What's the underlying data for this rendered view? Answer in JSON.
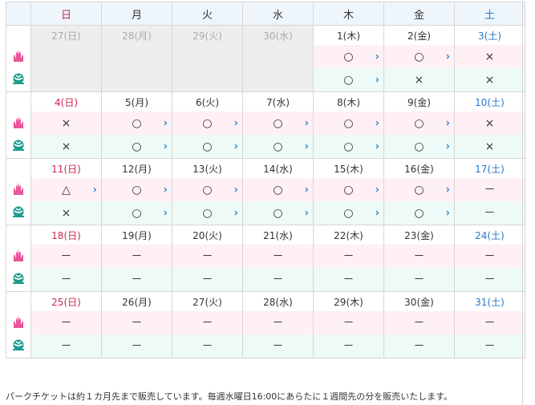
{
  "header": {
    "days": [
      {
        "label": "日",
        "kind": "sun"
      },
      {
        "label": "月",
        "kind": "wd"
      },
      {
        "label": "火",
        "kind": "wd"
      },
      {
        "label": "水",
        "kind": "wd"
      },
      {
        "label": "木",
        "kind": "wd"
      },
      {
        "label": "金",
        "kind": "wd"
      },
      {
        "label": "土",
        "kind": "sat"
      }
    ]
  },
  "park_icons": {
    "land": "castle-icon",
    "sea": "globe-icon"
  },
  "colors": {
    "sunday": "#c8294f",
    "saturday": "#2677c8",
    "land_bg": "#fff0f6",
    "sea_bg": "#eefaf7",
    "arrow": "#2b88c8"
  },
  "weeks": [
    {
      "days": [
        {
          "date": "27(日)",
          "kind": "sun",
          "other": true,
          "land": "",
          "land_link": false,
          "sea": "",
          "sea_link": false
        },
        {
          "date": "28(月)",
          "kind": "wd",
          "other": true,
          "land": "",
          "land_link": false,
          "sea": "",
          "sea_link": false
        },
        {
          "date": "29(火)",
          "kind": "wd",
          "other": true,
          "land": "",
          "land_link": false,
          "sea": "",
          "sea_link": false
        },
        {
          "date": "30(水)",
          "kind": "wd",
          "other": true,
          "land": "",
          "land_link": false,
          "sea": "",
          "sea_link": false
        },
        {
          "date": "1(木)",
          "kind": "wd",
          "other": false,
          "land": "○",
          "land_link": true,
          "sea": "○",
          "sea_link": true
        },
        {
          "date": "2(金)",
          "kind": "wd",
          "other": false,
          "land": "○",
          "land_link": true,
          "sea": "×",
          "sea_link": false
        },
        {
          "date": "3(土)",
          "kind": "sat",
          "other": false,
          "land": "×",
          "land_link": false,
          "sea": "×",
          "sea_link": false
        }
      ]
    },
    {
      "days": [
        {
          "date": "4(日)",
          "kind": "sun",
          "other": false,
          "land": "×",
          "land_link": false,
          "sea": "×",
          "sea_link": false
        },
        {
          "date": "5(月)",
          "kind": "wd",
          "other": false,
          "land": "○",
          "land_link": true,
          "sea": "○",
          "sea_link": true
        },
        {
          "date": "6(火)",
          "kind": "wd",
          "other": false,
          "land": "○",
          "land_link": true,
          "sea": "○",
          "sea_link": true
        },
        {
          "date": "7(水)",
          "kind": "wd",
          "other": false,
          "land": "○",
          "land_link": true,
          "sea": "○",
          "sea_link": true
        },
        {
          "date": "8(木)",
          "kind": "wd",
          "other": false,
          "land": "○",
          "land_link": true,
          "sea": "○",
          "sea_link": true
        },
        {
          "date": "9(金)",
          "kind": "wd",
          "other": false,
          "land": "○",
          "land_link": true,
          "sea": "○",
          "sea_link": true
        },
        {
          "date": "10(土)",
          "kind": "sat",
          "other": false,
          "land": "×",
          "land_link": false,
          "sea": "×",
          "sea_link": false
        }
      ]
    },
    {
      "days": [
        {
          "date": "11(日)",
          "kind": "sun",
          "other": false,
          "land": "△",
          "land_link": true,
          "sea": "×",
          "sea_link": false
        },
        {
          "date": "12(月)",
          "kind": "wd",
          "other": false,
          "land": "○",
          "land_link": true,
          "sea": "○",
          "sea_link": true
        },
        {
          "date": "13(火)",
          "kind": "wd",
          "other": false,
          "land": "○",
          "land_link": true,
          "sea": "○",
          "sea_link": true
        },
        {
          "date": "14(水)",
          "kind": "wd",
          "other": false,
          "land": "○",
          "land_link": true,
          "sea": "○",
          "sea_link": true
        },
        {
          "date": "15(木)",
          "kind": "wd",
          "other": false,
          "land": "○",
          "land_link": true,
          "sea": "○",
          "sea_link": true
        },
        {
          "date": "16(金)",
          "kind": "wd",
          "other": false,
          "land": "○",
          "land_link": true,
          "sea": "○",
          "sea_link": true
        },
        {
          "date": "17(土)",
          "kind": "sat",
          "other": false,
          "land": "－",
          "land_link": false,
          "sea": "－",
          "sea_link": false
        }
      ]
    },
    {
      "days": [
        {
          "date": "18(日)",
          "kind": "sun",
          "other": false,
          "land": "－",
          "land_link": false,
          "sea": "－",
          "sea_link": false
        },
        {
          "date": "19(月)",
          "kind": "wd",
          "other": false,
          "land": "－",
          "land_link": false,
          "sea": "－",
          "sea_link": false
        },
        {
          "date": "20(火)",
          "kind": "wd",
          "other": false,
          "land": "－",
          "land_link": false,
          "sea": "－",
          "sea_link": false
        },
        {
          "date": "21(水)",
          "kind": "wd",
          "other": false,
          "land": "－",
          "land_link": false,
          "sea": "－",
          "sea_link": false
        },
        {
          "date": "22(木)",
          "kind": "wd",
          "other": false,
          "land": "－",
          "land_link": false,
          "sea": "－",
          "sea_link": false
        },
        {
          "date": "23(金)",
          "kind": "wd",
          "other": false,
          "land": "－",
          "land_link": false,
          "sea": "－",
          "sea_link": false
        },
        {
          "date": "24(土)",
          "kind": "sat",
          "other": false,
          "land": "－",
          "land_link": false,
          "sea": "－",
          "sea_link": false
        }
      ]
    },
    {
      "days": [
        {
          "date": "25(日)",
          "kind": "sun",
          "other": false,
          "land": "－",
          "land_link": false,
          "sea": "－",
          "sea_link": false
        },
        {
          "date": "26(月)",
          "kind": "wd",
          "other": false,
          "land": "－",
          "land_link": false,
          "sea": "－",
          "sea_link": false
        },
        {
          "date": "27(火)",
          "kind": "wd",
          "other": false,
          "land": "－",
          "land_link": false,
          "sea": "－",
          "sea_link": false
        },
        {
          "date": "28(水)",
          "kind": "wd",
          "other": false,
          "land": "－",
          "land_link": false,
          "sea": "－",
          "sea_link": false
        },
        {
          "date": "29(木)",
          "kind": "wd",
          "other": false,
          "land": "－",
          "land_link": false,
          "sea": "－",
          "sea_link": false
        },
        {
          "date": "30(金)",
          "kind": "wd",
          "other": false,
          "land": "－",
          "land_link": false,
          "sea": "－",
          "sea_link": false
        },
        {
          "date": "31(土)",
          "kind": "sat",
          "other": false,
          "land": "－",
          "land_link": false,
          "sea": "－",
          "sea_link": false
        }
      ]
    }
  ],
  "footnote": "パークチケットは約１カ月先まで販売しています。毎週水曜日16:00にあらたに１週間先の分を販売いたします。"
}
